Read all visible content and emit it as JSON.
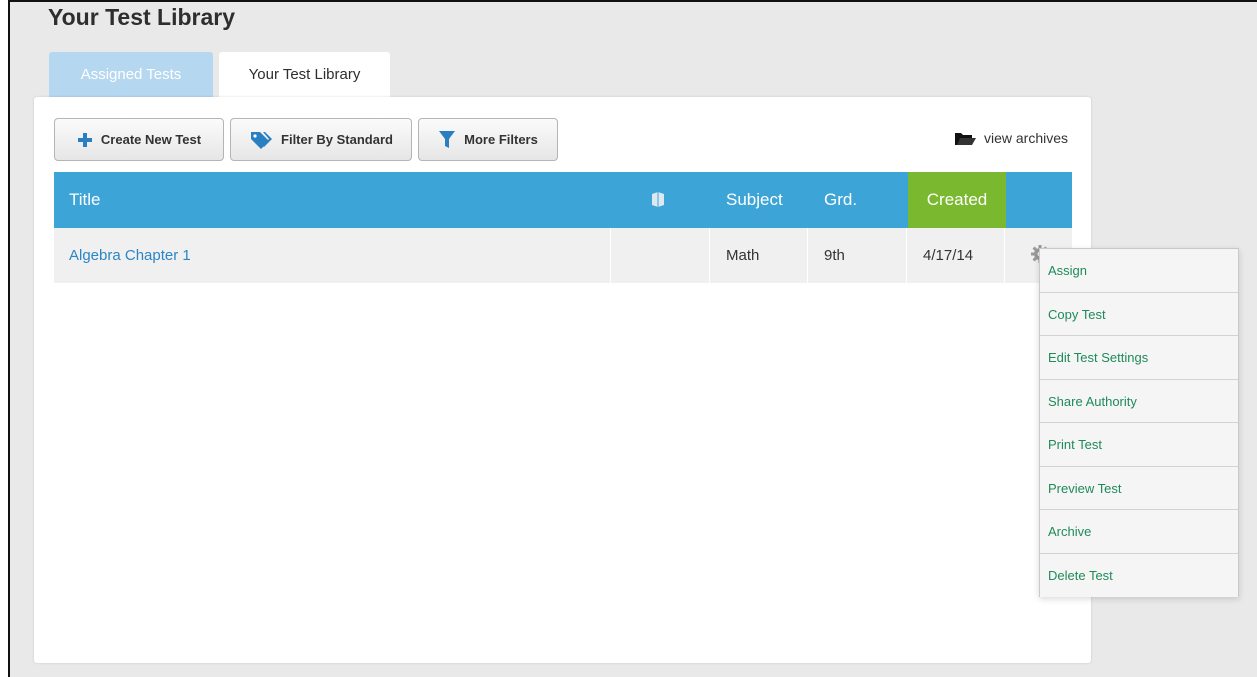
{
  "page": {
    "title": "Your Test Library"
  },
  "tabs": [
    {
      "label": "Assigned Tests",
      "active": false
    },
    {
      "label": "Your Test Library",
      "active": true
    }
  ],
  "toolbar": {
    "create_label": "Create New Test",
    "standard_label": "Filter By Standard",
    "filters_label": "More Filters",
    "archives_label": "view archives"
  },
  "table": {
    "columns": {
      "title": "Title",
      "icon": "book-icon",
      "subject": "Subject",
      "grade": "Grd.",
      "created": "Created"
    },
    "rows": [
      {
        "title": "Algebra Chapter 1",
        "subject": "Math",
        "grade": "9th",
        "created": "4/17/14"
      }
    ]
  },
  "context_menu": {
    "items": [
      "Assign",
      "Copy Test",
      "Edit Test Settings",
      "Share Authority",
      "Print Test",
      "Preview Test",
      "Archive",
      "Delete Test"
    ]
  },
  "colors": {
    "header_blue": "#3ca4d6",
    "created_green": "#7ab82f",
    "link_blue": "#2a86c6",
    "menu_green": "#1f8a5a"
  }
}
